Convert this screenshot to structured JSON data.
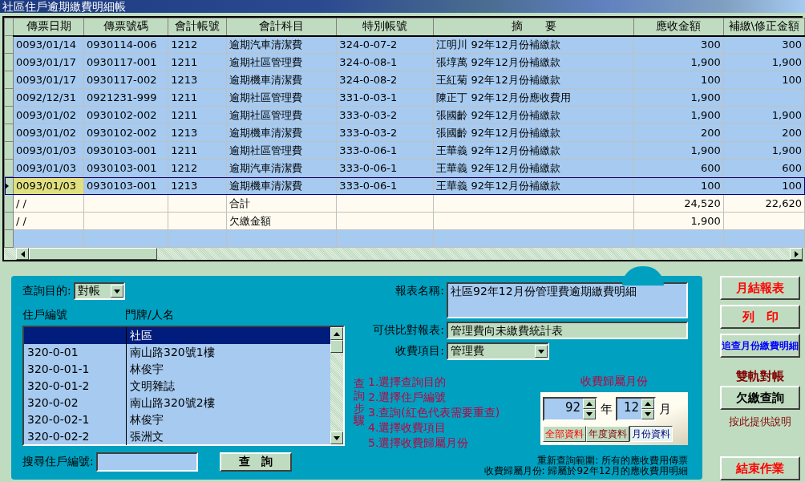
{
  "window": {
    "title": "社區住戶逾期繳費明細帳"
  },
  "table": {
    "columns": [
      {
        "label": "傳票日期",
        "kind": "text"
      },
      {
        "label": "傳票號碼",
        "kind": "text"
      },
      {
        "label": "會計帳號",
        "kind": "text"
      },
      {
        "label": "會計科目",
        "kind": "text"
      },
      {
        "label": "特別帳號",
        "kind": "text"
      },
      {
        "label": "摘　　要",
        "kind": "text"
      },
      {
        "label": "應收金額",
        "kind": "number"
      },
      {
        "label": "補繳\\修正金額",
        "kind": "number"
      }
    ],
    "rows": [
      {
        "selected": false,
        "cells": [
          "0093/01/14",
          "0930114-006",
          "1212",
          "逾期汽車清潔費",
          "324-0-07-2",
          "江明川  92年12月份補繳款",
          "300",
          "300"
        ]
      },
      {
        "selected": false,
        "cells": [
          "0093/01/17",
          "0930117-001",
          "1211",
          "逾期社區管理費",
          "324-0-08-1",
          "張埻萬  92年12月份補繳款",
          "1,900",
          "1,900"
        ]
      },
      {
        "selected": false,
        "cells": [
          "0093/01/17",
          "0930117-002",
          "1213",
          "逾期機車清潔費",
          "324-0-08-2",
          "王紅菊  92年12月份補繳款",
          "100",
          "100"
        ]
      },
      {
        "selected": false,
        "cells": [
          "0092/12/31",
          "0921231-999",
          "1211",
          "逾期社區管理費",
          "331-0-03-1",
          "陳正丁  92年12月份應收費用",
          "1,900",
          ""
        ]
      },
      {
        "selected": false,
        "cells": [
          "0093/01/02",
          "0930102-002",
          "1211",
          "逾期社區管理費",
          "333-0-03-2",
          "張國齡  92年12月份補繳款",
          "1,900",
          "1,900"
        ]
      },
      {
        "selected": false,
        "cells": [
          "0093/01/02",
          "0930102-002",
          "1213",
          "逾期機車清潔費",
          "333-0-03-2",
          "張國齡  92年12月份補繳款",
          "200",
          "200"
        ]
      },
      {
        "selected": false,
        "cells": [
          "0093/01/03",
          "0930103-001",
          "1211",
          "逾期社區管理費",
          "333-0-06-1",
          "王華義  92年12月份補繳款",
          "1,900",
          "1,900"
        ]
      },
      {
        "selected": false,
        "cells": [
          "0093/01/03",
          "0930103-001",
          "1212",
          "逾期汽車清潔費",
          "333-0-06-1",
          "王華義  92年12月份補繳款",
          "600",
          "600"
        ]
      },
      {
        "selected": true,
        "cells": [
          "0093/01/03",
          "0930103-001",
          "1213",
          "逾期機車清潔費",
          "333-0-06-1",
          "王華義  92年12月份補繳款",
          "100",
          "100"
        ]
      }
    ],
    "totals": [
      {
        "cells": [
          "/   /",
          "",
          "",
          "合計",
          "",
          "",
          "24,520",
          "22,620"
        ]
      },
      {
        "cells": [
          "/   /",
          "",
          "",
          "欠繳金額",
          "",
          "",
          "1,900",
          ""
        ]
      }
    ]
  },
  "query": {
    "purpose_label": "查詢目的:",
    "purpose_value": "對帳",
    "list_headers": [
      "住戶編號",
      "門牌/人名"
    ],
    "residents": [
      {
        "name": "社區",
        "selected": true
      },
      {
        "id": "320-0-01",
        "name": "南山路320號1樓",
        "selected": false
      },
      {
        "id": "320-0-01-1",
        "name": "林俊宇",
        "selected": false
      },
      {
        "id": "320-0-01-2",
        "name": "文明雜誌",
        "selected": false
      },
      {
        "id": "320-0-02",
        "name": "南山路320號2樓",
        "selected": false
      },
      {
        "id": "320-0-02-1",
        "name": "林俊宇",
        "selected": false
      },
      {
        "id": "320-0-02-2",
        "name": "張洲文",
        "selected": false
      }
    ],
    "search_label": "搜尋住戶編號:",
    "search_button": "查　詢"
  },
  "report": {
    "name_label": "報表名稱:",
    "name_value": "社區92年12月份管理費逾期繳費明細",
    "compare_label": "可供比對報表:",
    "compare_value": "管理費向未繳費統計表",
    "item_label": "收費項目:",
    "item_value": "管理費",
    "steps_title": "查詢步驟",
    "steps": [
      "1.選擇查詢目的",
      "2.選擇住戶編號",
      "3.查詢(紅色代表需要重查)",
      "4.選擇收費項目",
      "5.選擇收費歸屬月份"
    ],
    "month_title": "收費歸屬月份",
    "year_value": "92",
    "year_unit": "年",
    "month_value": "12",
    "month_unit": "月",
    "scopes": [
      {
        "label": "全部資料",
        "selected": false
      },
      {
        "label": "年度資料",
        "selected": false
      },
      {
        "label": "月份資料",
        "selected": true
      }
    ],
    "notes": [
      "重新查詢範圍: 所有的應收費用傳票",
      "收費歸屬月份: 歸屬於92年12月的應收費用明細"
    ]
  },
  "actions": [
    {
      "kind": "button",
      "label": "月結報表",
      "color": "#ff0000"
    },
    {
      "kind": "button",
      "label": "列　印",
      "color": "#ff0000"
    },
    {
      "kind": "button",
      "label": "追查月份繳費明細",
      "color": "#0000ff"
    },
    {
      "kind": "heading",
      "label": "雙軌對帳",
      "color": "#800000"
    },
    {
      "kind": "button",
      "label": "欠繳查詢",
      "color": "#000000"
    },
    {
      "kind": "note",
      "label": "按此提供說明"
    },
    {
      "kind": "button",
      "label": "結束作業",
      "color": "#ff0000"
    }
  ]
}
